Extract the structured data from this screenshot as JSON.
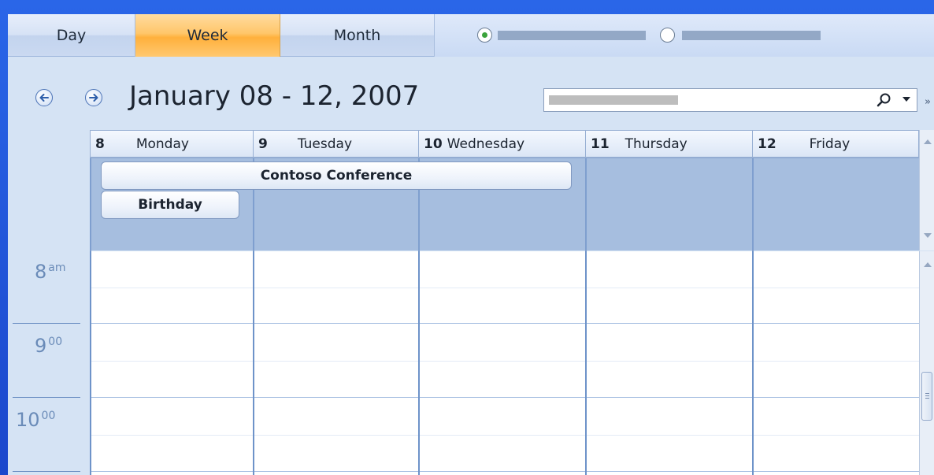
{
  "view_tabs": [
    {
      "label": "Day"
    },
    {
      "label": "Week"
    },
    {
      "label": "Month"
    }
  ],
  "selected_view": "Week",
  "view_options": {
    "radio_1_checked": true,
    "radio_2_checked": false
  },
  "header": {
    "title": "January 08 - 12, 2007"
  },
  "search": {
    "value": ""
  },
  "days": [
    {
      "number": "8",
      "name": "Monday"
    },
    {
      "number": "9",
      "name": "Tuesday"
    },
    {
      "number": "10",
      "name": "Wednesday"
    },
    {
      "number": "11",
      "name": "Thursday"
    },
    {
      "number": "12",
      "name": "Friday"
    }
  ],
  "all_day_events": [
    {
      "title": "Contoso Conference"
    },
    {
      "title": "Birthday"
    }
  ],
  "time_labels": [
    {
      "hour": "8",
      "suffix": "am"
    },
    {
      "hour": "9",
      "suffix": "00"
    },
    {
      "hour": "10",
      "suffix": "00"
    }
  ],
  "colors": {
    "frame": "#1f4fd8",
    "selected_tab": "#ffc66a",
    "all_day_bg": "#a6bedf",
    "grid_line": "#6e93c9"
  }
}
